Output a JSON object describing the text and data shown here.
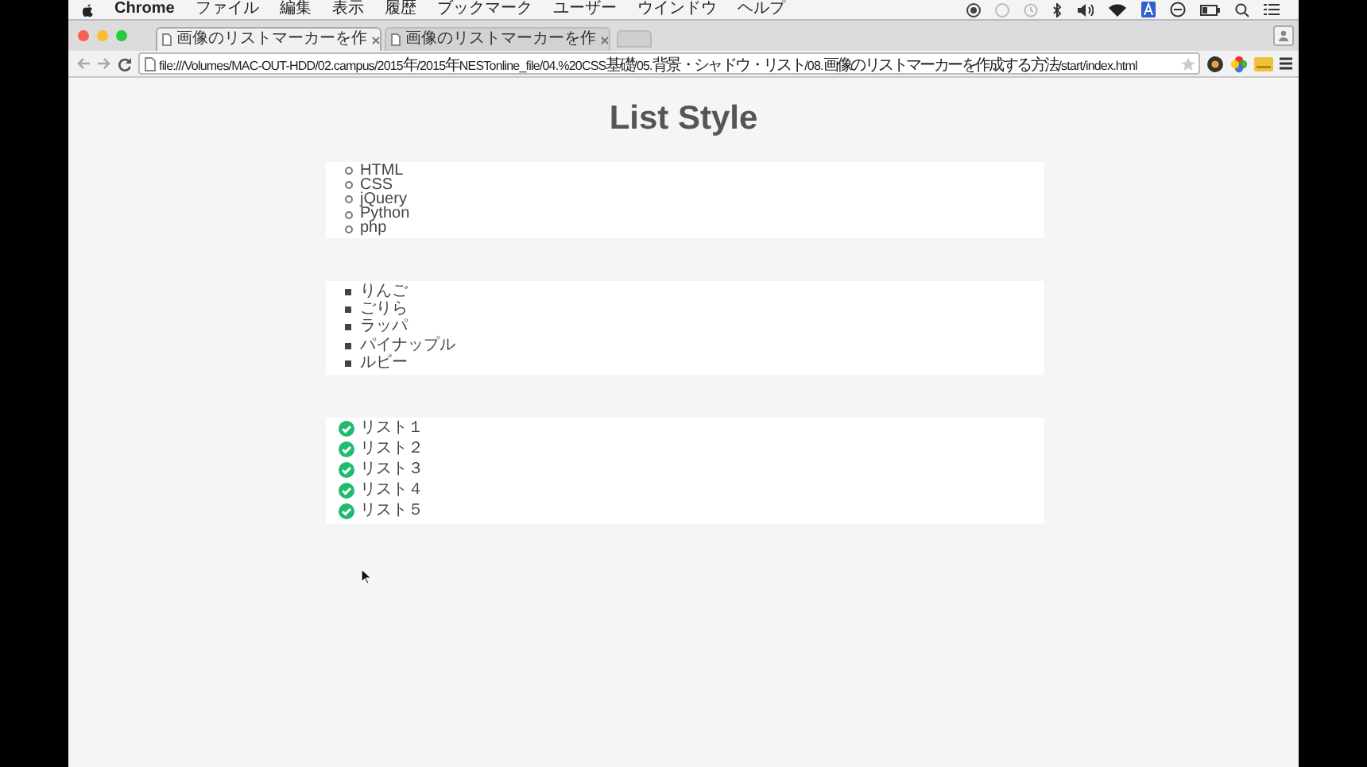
{
  "menu_bar": {
    "app": "Chrome",
    "items": [
      "ファイル",
      "編集",
      "表示",
      "履歴",
      "ブックマーク",
      "ユーザー",
      "ウインドウ",
      "ヘルプ"
    ]
  },
  "tabs": [
    {
      "title": "画像のリストマーカーを作",
      "selected": true
    },
    {
      "title": "画像のリストマーカーを作",
      "selected": false
    }
  ],
  "address_bar": {
    "url": "file:///Volumes/MAC-OUT-HDD/02.campus/2015年/2015年NESTonline_file/04.%20CSS基礎/05.背景・シャドウ・リスト/08.画像のリストマーカーを作成する方法/start/index.html"
  },
  "page": {
    "title": "List Style",
    "lists": [
      {
        "kind": "circle",
        "items": [
          "HTML",
          "CSS",
          "jQuery",
          "Python",
          "php"
        ]
      },
      {
        "kind": "square",
        "items": [
          "りんご",
          "ごりら",
          "ラッパ",
          "パイナップル",
          "ルビー"
        ]
      },
      {
        "kind": "check",
        "items": [
          "リスト１",
          "リスト２",
          "リスト３",
          "リスト４",
          "リスト５"
        ]
      }
    ]
  }
}
